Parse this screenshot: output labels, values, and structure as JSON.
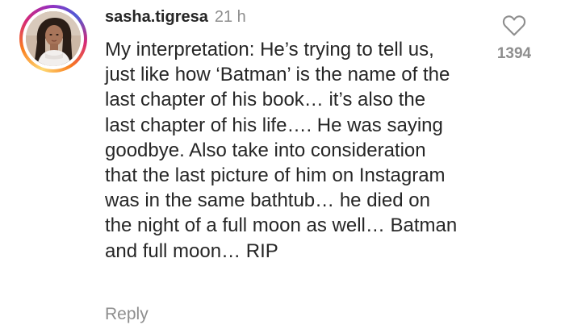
{
  "comment": {
    "username": "sasha.tigresa",
    "time": "21 h",
    "text": "My interpretation: He’s trying to tell us, just like how ‘Batman’ is the name of the last chapter of his book… it’s also the last chapter of his life…. He was saying goodbye. Also take into consideration that the last picture of him on Instagram was in the same bathtub… he died on the night of a full moon as well… Batman and full moon… RIP",
    "reply_label": "Reply",
    "like_count": "1394",
    "like_icon": "heart-outline-icon",
    "colors": {
      "text": "#262626",
      "secondary": "#8e8e8e"
    }
  }
}
